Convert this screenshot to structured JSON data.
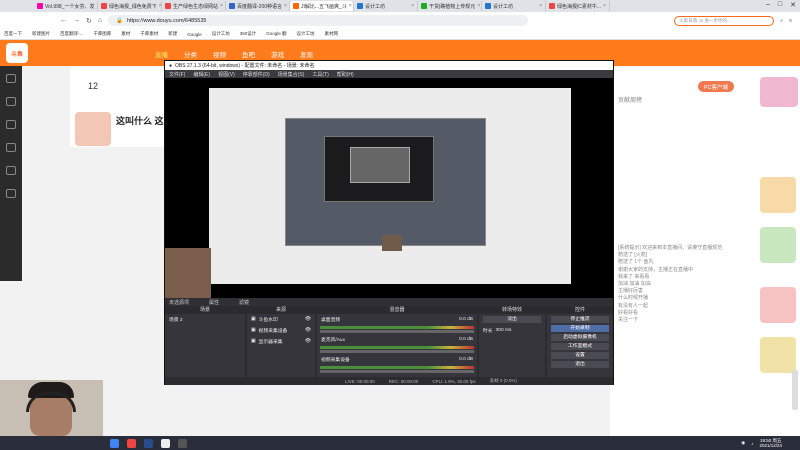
{
  "browser": {
    "tabs": [
      {
        "label": "Vol.998_一个女芬、发",
        "color": "#f0a"
      },
      {
        "label": "绿色海报_绿色免费下",
        "color": "#e44"
      },
      {
        "label": "生产绿色生态绿网站",
        "color": "#e44"
      },
      {
        "label": "百度翻译-200种语言",
        "color": "#36c"
      },
      {
        "label": "JI解比...五飞画爽_斗",
        "color": "#f60",
        "active": true
      },
      {
        "label": "设计工坊",
        "color": "#27c"
      },
      {
        "label": "干货|确植物上传规元",
        "color": "#2a2"
      },
      {
        "label": "设计工坊",
        "color": "#27c"
      },
      {
        "label": "绿色海报|C素材牛...",
        "color": "#e44"
      }
    ],
    "url": "https://www.douyu.com/6485535",
    "search_placeholder": "火影日落 Jo 进一步你的...",
    "bookmarks": [
      "百度一下",
      "新建图片",
      "百度翻译-...",
      "千库图库",
      "素材",
      "千库素材",
      "新建",
      "Google",
      "设计工坊",
      "360设计",
      "Google 翻",
      "设计工坊",
      "素材网"
    ]
  },
  "douyu": {
    "logo": "斗鱼",
    "nav": [
      "直播",
      "分类",
      "视频",
      "鱼吧",
      "游戏",
      "发现"
    ],
    "room_title": "这叫什么 这叫什",
    "room_number": "12",
    "right_tag": "PC客户端",
    "rank_title": "贡献周榜",
    "chat_lines": [
      "[系统提示] 欢迎来到本直播间，请遵守直播规范",
      "赠送了 [火箭]",
      "赠送了 1个 鱼丸",
      "谢谢大家的支持，主播正在直播中",
      "我来了 来看看",
      "加油 加油 加油",
      "主播好厉害",
      "什么时候开播",
      "有没有人一起",
      "好看好看",
      "关注一下"
    ]
  },
  "obs": {
    "title": "OBS 27.1.3 (64-bit, windows) - 配置文件: 未命名 - 场景: 未命名",
    "menu": [
      "文件(F)",
      "编辑(E)",
      "视图(V)",
      "停靠部件(D)",
      "场景集合(S)",
      "工具(T)",
      "帮助(H)"
    ],
    "scene_bar": "未选源项",
    "properties_label": "属性",
    "filters_label": "滤镜",
    "docks": {
      "scenes": {
        "title": "场景",
        "items": [
          "场景 2"
        ]
      },
      "sources": {
        "title": "来源",
        "items": [
          "斗鱼水印",
          "视频采集设备",
          "显示器采集"
        ]
      },
      "mixer": {
        "title": "混音器",
        "channels": [
          {
            "name": "桌面音频",
            "value": "0.0 dB"
          },
          {
            "name": "麦克风/Aux",
            "value": "0.0 dB"
          },
          {
            "name": "视频采集设备",
            "value": "0.0 dB"
          }
        ]
      },
      "transitions": {
        "title": "转场特效",
        "type": "淡出",
        "duration_label": "时长",
        "duration": "300 ms"
      },
      "controls": {
        "title": "控件",
        "buttons": [
          "停止推流",
          "开始录制",
          "启动虚拟摄像机",
          "工作室模式",
          "设置",
          "退出"
        ]
      }
    },
    "status": [
      "LIVE: 00:00:00",
      "REC: 00:00:00",
      "CPU: 1.9%, 30.00 fps",
      "丢帧 0 (0.0%)"
    ]
  },
  "taskbar": {
    "time": "19:50 周五",
    "date": "2021/12/24"
  }
}
